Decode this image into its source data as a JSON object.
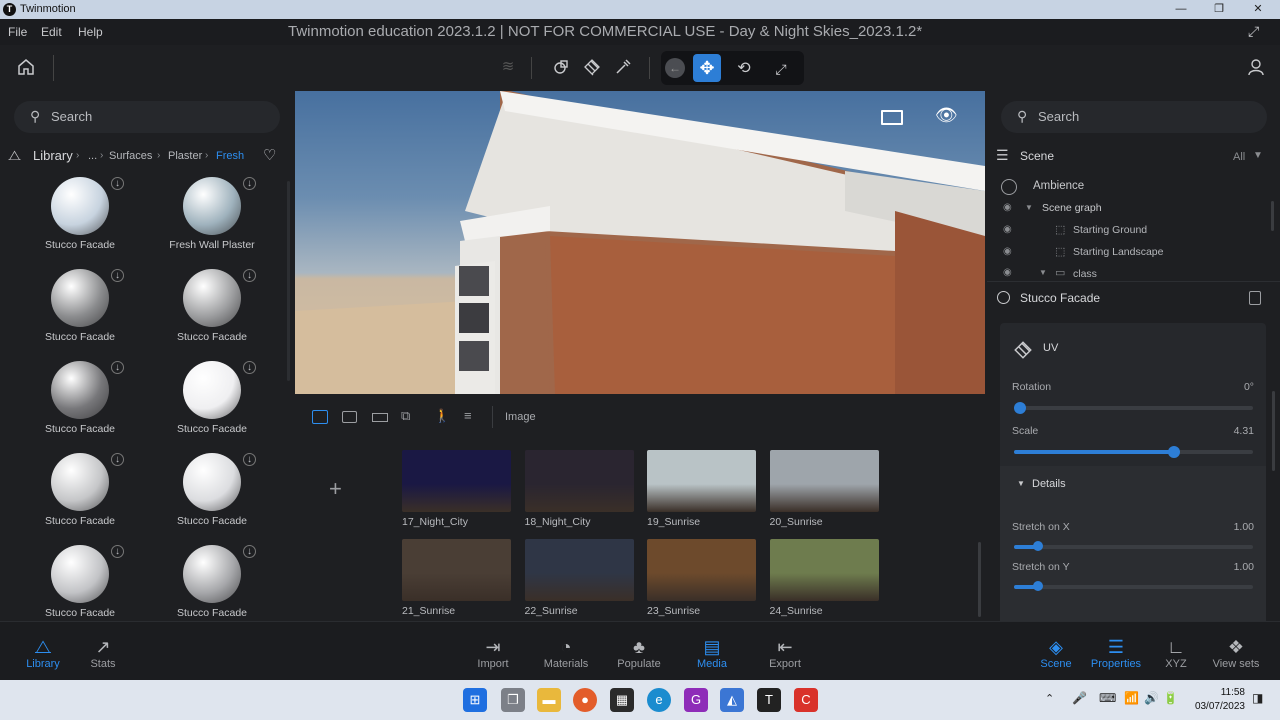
{
  "window": {
    "app_name": "Twinmotion",
    "logo_letter": "T",
    "minimize": "—",
    "maximize": "❐",
    "close": "✕"
  },
  "menubar": {
    "items": [
      "File",
      "Edit",
      "Help"
    ],
    "document_title": "Twinmotion education 2023.1.2 | NOT FOR COMMERCIAL USE - Day & Night Skies_2023.1.2*"
  },
  "library": {
    "search_placeholder": "Search",
    "title": "Library",
    "crumbs": [
      "...",
      "Surfaces",
      "Plaster",
      "Fresh"
    ],
    "separator": "›",
    "materials": [
      {
        "label": "Stucco Facade",
        "color": "#c7d3df"
      },
      {
        "label": "Fresh Wall Plaster",
        "color": "#9fb2bd"
      },
      {
        "label": "Stucco Facade",
        "color": "#8b8c8e"
      },
      {
        "label": "Stucco Facade",
        "color": "#9d9ea0"
      },
      {
        "label": "Stucco Facade",
        "color": "#77777a"
      },
      {
        "label": "Stucco Facade",
        "color": "#efeff1"
      },
      {
        "label": "Stucco Facade",
        "color": "#c5c6c8"
      },
      {
        "label": "Stucco Facade",
        "color": "#dcdde0"
      },
      {
        "label": "Stucco Facade",
        "color": "#c2c3c6"
      },
      {
        "label": "Stucco Facade",
        "color": "#a6a7aa"
      }
    ]
  },
  "media": {
    "tab_label": "Image",
    "add_symbol": "+",
    "thumbnails": [
      {
        "label": "17_Night_City",
        "color": "#1a1844"
      },
      {
        "label": "18_Night_City",
        "color": "#2a2530"
      },
      {
        "label": "19_Sunrise",
        "color": "#b9c3c6"
      },
      {
        "label": "20_Sunrise",
        "color": "#9ea5ab"
      },
      {
        "label": "21_Sunrise",
        "color": "#4a3e35"
      },
      {
        "label": "22_Sunrise",
        "color": "#2f3646"
      },
      {
        "label": "23_Sunrise",
        "color": "#6d4a2c"
      },
      {
        "label": "24_Sunrise",
        "color": "#6e7c4e"
      }
    ]
  },
  "scene": {
    "search_placeholder": "Search",
    "title": "Scene",
    "filter": "All",
    "tree": [
      {
        "label": "Ambience"
      },
      {
        "label": "Scene graph"
      },
      {
        "label": "Starting Ground"
      },
      {
        "label": "Starting Landscape"
      },
      {
        "label": "class"
      }
    ]
  },
  "properties": {
    "object_name": "Stucco Facade",
    "section": "UV",
    "details_label": "Details",
    "rotation": {
      "label": "Rotation",
      "value": "0°",
      "fraction": 0.0
    },
    "scale": {
      "label": "Scale",
      "value": "4.31",
      "fraction": 0.67
    },
    "stretch_x": {
      "label": "Stretch on X",
      "value": "1.00",
      "fraction": 0.1
    },
    "stretch_y": {
      "label": "Stretch on Y",
      "value": "1.00",
      "fraction": 0.1
    }
  },
  "bottombar": {
    "left": [
      {
        "label": "Library",
        "active": true,
        "icon": "library-icon"
      },
      {
        "label": "Stats",
        "active": false,
        "icon": "stats-icon"
      }
    ],
    "center": [
      {
        "label": "Import",
        "active": false,
        "icon": "import-icon"
      },
      {
        "label": "Materials",
        "active": false,
        "icon": "materials-icon"
      },
      {
        "label": "Populate",
        "active": false,
        "icon": "populate-icon"
      },
      {
        "label": "Media",
        "active": true,
        "icon": "media-icon"
      },
      {
        "label": "Export",
        "active": false,
        "icon": "export-icon"
      }
    ],
    "right": [
      {
        "label": "Scene",
        "active": true,
        "icon": "scene-icon"
      },
      {
        "label": "Properties",
        "active": true,
        "icon": "properties-icon"
      },
      {
        "label": "XYZ",
        "active": false,
        "icon": "xyz-icon"
      },
      {
        "label": "View sets",
        "active": false,
        "icon": "view-sets-icon"
      }
    ]
  },
  "taskbar": {
    "time": "11:58",
    "date": "03/07/2023"
  },
  "colors": {
    "accent": "#2d8ef0",
    "background": "#1e1f22"
  }
}
